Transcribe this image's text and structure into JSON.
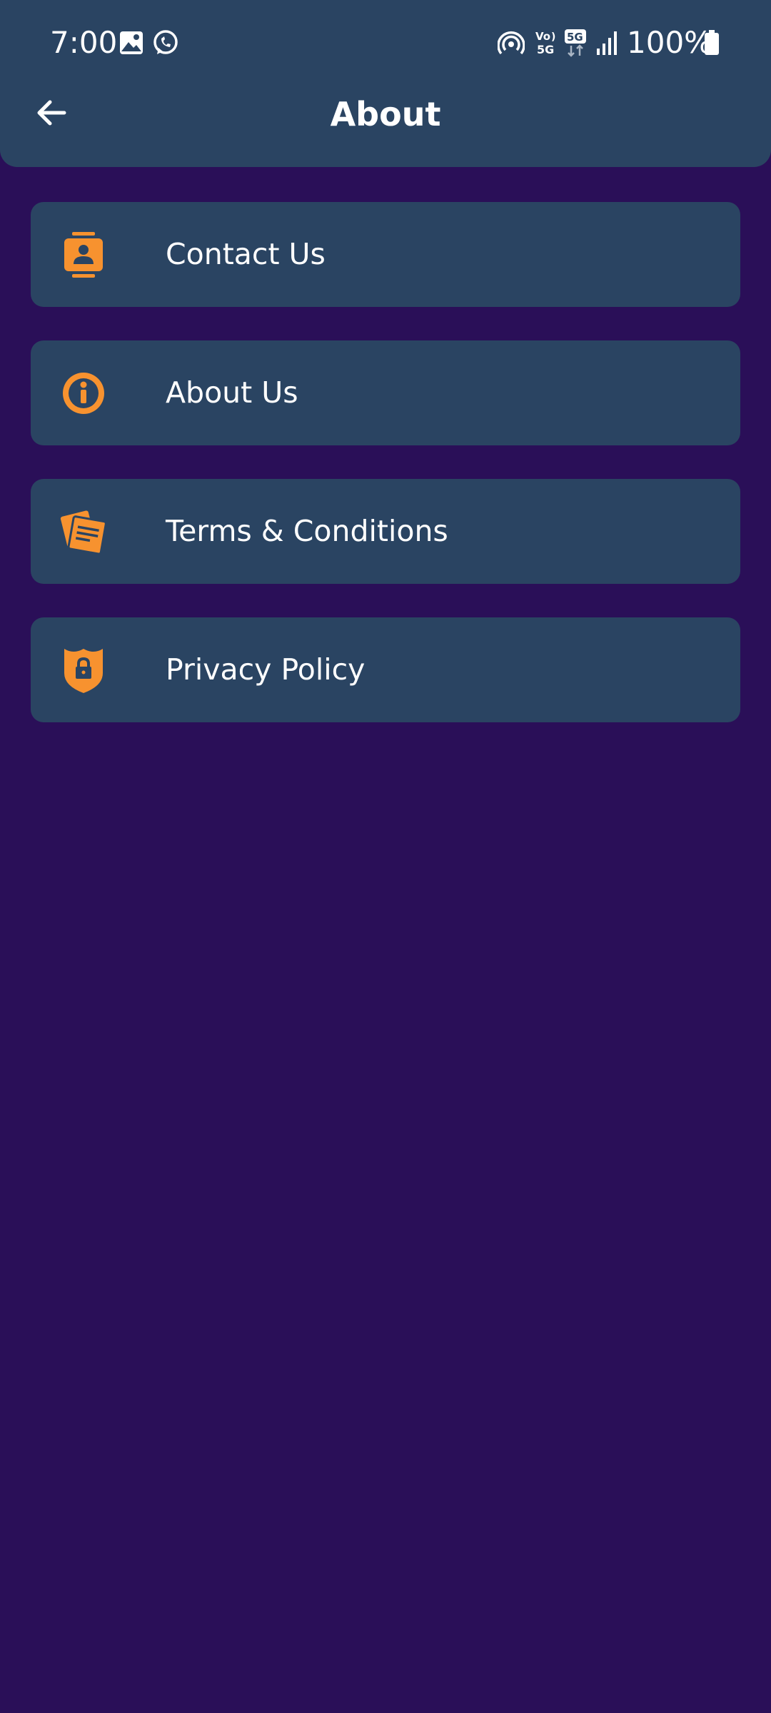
{
  "status_bar": {
    "time": "7:00",
    "battery": "100%",
    "icons": [
      "gallery-icon",
      "whatsapp-icon",
      "hotspot-icon",
      "volte-icon",
      "5g-icon",
      "signal-icon",
      "battery-icon"
    ]
  },
  "header": {
    "title": "About",
    "back_icon": "arrow-left-icon"
  },
  "menu": {
    "items": [
      {
        "label": "Contact Us",
        "icon": "contact-card-icon"
      },
      {
        "label": "About Us",
        "icon": "info-icon"
      },
      {
        "label": "Terms & Conditions",
        "icon": "notes-icon"
      },
      {
        "label": "Privacy Policy",
        "icon": "shield-lock-icon"
      }
    ]
  },
  "colors": {
    "background": "#2a0f58",
    "surface": "#2a4462",
    "accent": "#f7922f",
    "text": "#ffffff"
  }
}
